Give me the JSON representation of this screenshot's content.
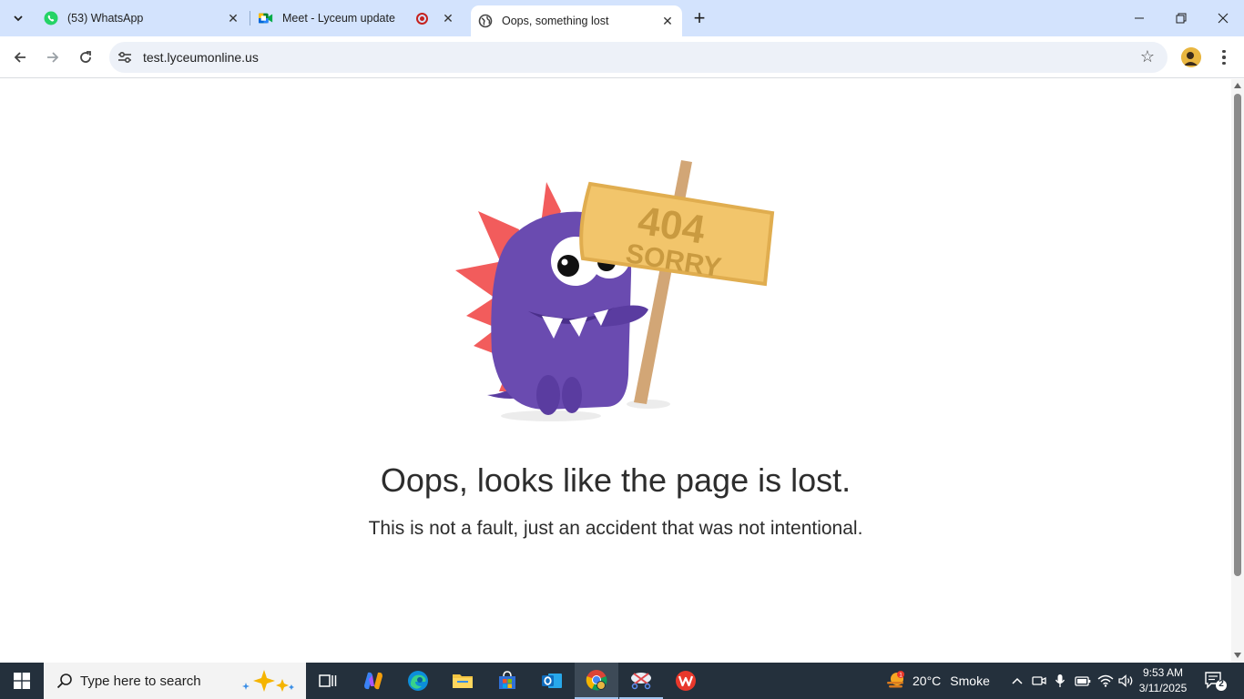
{
  "browser": {
    "tabs": [
      {
        "title": "(53) WhatsApp",
        "favicon": "whatsapp-icon"
      },
      {
        "title": "Meet - Lyceum update",
        "favicon": "google-meet-icon",
        "recording": true
      },
      {
        "title": "Oops, something lost",
        "favicon": "globe-icon",
        "active": true
      }
    ],
    "url": "test.lyceumonline.us"
  },
  "page": {
    "sign_line1": "404",
    "sign_line2": "SORRY",
    "heading": "Oops, looks like the page is lost.",
    "subtext": "This is not a fault, just an accident that was not intentional."
  },
  "taskbar": {
    "search_placeholder": "Type here to search",
    "weather_temp": "20°C",
    "weather_text": "Smoke",
    "time": "9:53 AM",
    "date": "3/11/2025",
    "notification_count": "2",
    "weather_badge": "1"
  },
  "colors": {
    "tabstrip": "#d3e3fd",
    "monster": "#6a4bb0",
    "spikes": "#f25c5c",
    "sign": "#f2c56b",
    "taskbar": "#24303c"
  }
}
